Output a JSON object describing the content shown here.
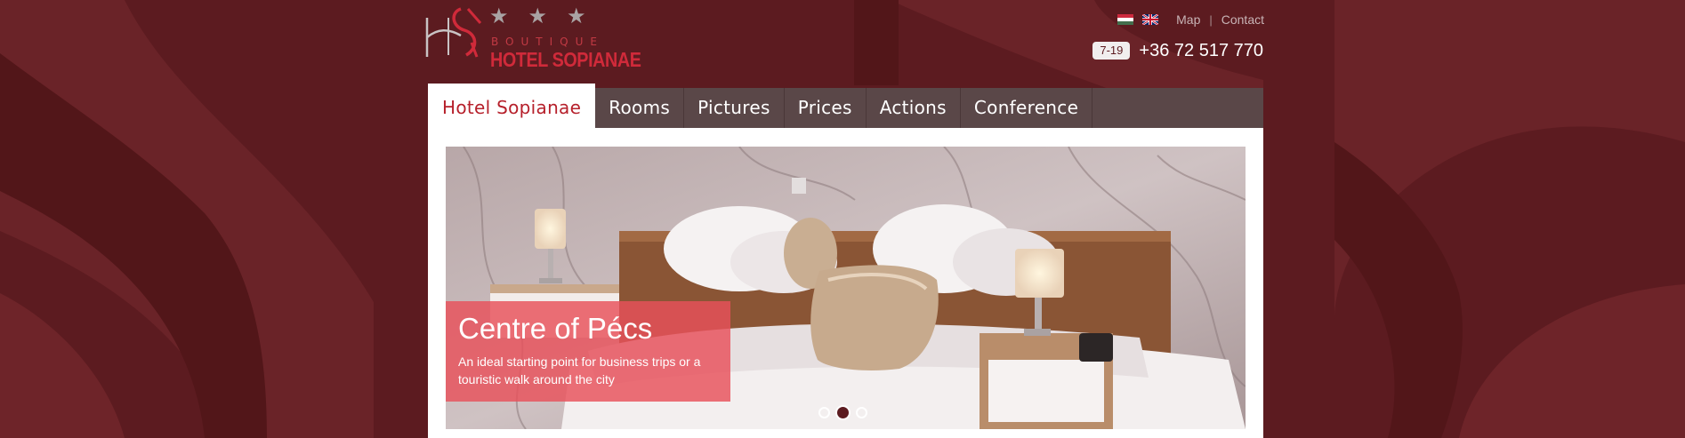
{
  "header": {
    "logo": {
      "stars": [
        "★",
        "★",
        "★"
      ],
      "boutique": "BOUTIQUE",
      "name": "HOTEL SOPIANAE"
    },
    "languages": [
      {
        "icon": "hungarian-flag-icon"
      },
      {
        "icon": "uk-flag-icon"
      }
    ],
    "links": {
      "map": "Map",
      "separator": "|",
      "contact": "Contact"
    },
    "hours": "7-19",
    "phone": "+36 72 517 770"
  },
  "nav": {
    "items": [
      {
        "label": "Hotel Sopianae",
        "active": true
      },
      {
        "label": "Rooms"
      },
      {
        "label": "Pictures"
      },
      {
        "label": "Prices"
      },
      {
        "label": "Actions"
      },
      {
        "label": "Conference"
      }
    ]
  },
  "slider": {
    "caption_title": "Centre of Pécs",
    "caption_text": "An ideal starting point for business trips or a touristic walk around the city",
    "slide_count": 3,
    "active_slide": 2
  },
  "colors": {
    "background": "#5c1b20",
    "nav_bg": "#5a4748",
    "accent": "#b6202b",
    "caption_bg": "#e8505a"
  }
}
